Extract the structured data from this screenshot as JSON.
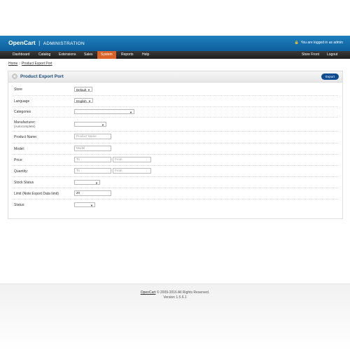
{
  "header": {
    "logo": "OpenCart",
    "logo_sep": "|",
    "logo_admin": "ADMINISTRATION",
    "logged_in": "You are logged in as admin"
  },
  "menu": {
    "items": [
      "Dashboard",
      "Catalog",
      "Extensions",
      "Sales",
      "System",
      "Reports",
      "Help"
    ],
    "active": "System",
    "right_items": [
      "Store Front",
      "Logout"
    ]
  },
  "breadcrumb": [
    "Home",
    "Product Export Port"
  ],
  "breadcrumb_sep": "::",
  "box": {
    "title": "Product Export Port",
    "export_button": "Export"
  },
  "form": {
    "store": {
      "label": "Store",
      "value": "Default"
    },
    "language": {
      "label": "Language",
      "value": "English"
    },
    "categories": {
      "label": "Categories",
      "value": ""
    },
    "manufacturer": {
      "label": "Manufacturer:",
      "sub": "(Autocomplete)",
      "value": ""
    },
    "product_name": {
      "label": "Product Name:",
      "placeholder": "Product Name"
    },
    "model": {
      "label": "Model:",
      "placeholder": "Model"
    },
    "price": {
      "label": "Price:",
      "to_placeholder": "To",
      "from_placeholder": "From",
      "sep": "-"
    },
    "quantity": {
      "label": "Quantity:",
      "to_placeholder": "To",
      "from_placeholder": "From",
      "sep": "-"
    },
    "stock_status": {
      "label": "Stock Status",
      "value": ""
    },
    "limit": {
      "label": "Limit (Note:Export Data limit)",
      "value": "20"
    },
    "status": {
      "label": "Status:",
      "value": ""
    }
  },
  "footer": {
    "brand": "OpenCart",
    "copyright": " © 2009-2016 All Rights Reserved.",
    "version": "Version 1.5.6.1"
  },
  "colors": {
    "header": "#1a74b3",
    "menu": "#2b2b2b",
    "menu_active": "#d96326",
    "export_button": "#0e4c94",
    "title": "#1d4a7a"
  }
}
